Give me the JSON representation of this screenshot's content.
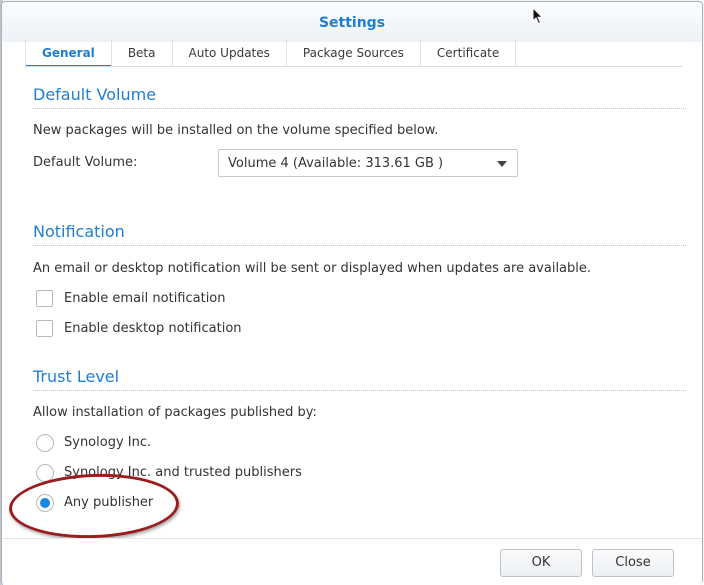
{
  "window": {
    "title": "Settings"
  },
  "tabs": [
    {
      "label": "General",
      "active": true
    },
    {
      "label": "Beta",
      "active": false
    },
    {
      "label": "Auto Updates",
      "active": false
    },
    {
      "label": "Package Sources",
      "active": false
    },
    {
      "label": "Certificate",
      "active": false
    }
  ],
  "default_volume": {
    "heading": "Default Volume",
    "description": "New packages will be installed on the volume specified below.",
    "field_label": "Default Volume:",
    "selected_value": "Volume 4 (Available: 313.61 GB )"
  },
  "notification": {
    "heading": "Notification",
    "description": "An email or desktop notification will be sent or displayed when updates are available.",
    "options": [
      {
        "label": "Enable email notification",
        "checked": false
      },
      {
        "label": "Enable desktop notification",
        "checked": false
      }
    ]
  },
  "trust_level": {
    "heading": "Trust Level",
    "description": "Allow installation of packages published by:",
    "options": [
      {
        "label": "Synology Inc.",
        "selected": false
      },
      {
        "label": "Synology Inc. and trusted publishers",
        "selected": false
      },
      {
        "label": "Any publisher",
        "selected": true
      }
    ]
  },
  "footer": {
    "ok_label": "OK",
    "close_label": "Close"
  },
  "colors": {
    "accent": "#1f7ed0",
    "annotation": "#9b1c1c",
    "radio_selected": "#1a86e0"
  }
}
